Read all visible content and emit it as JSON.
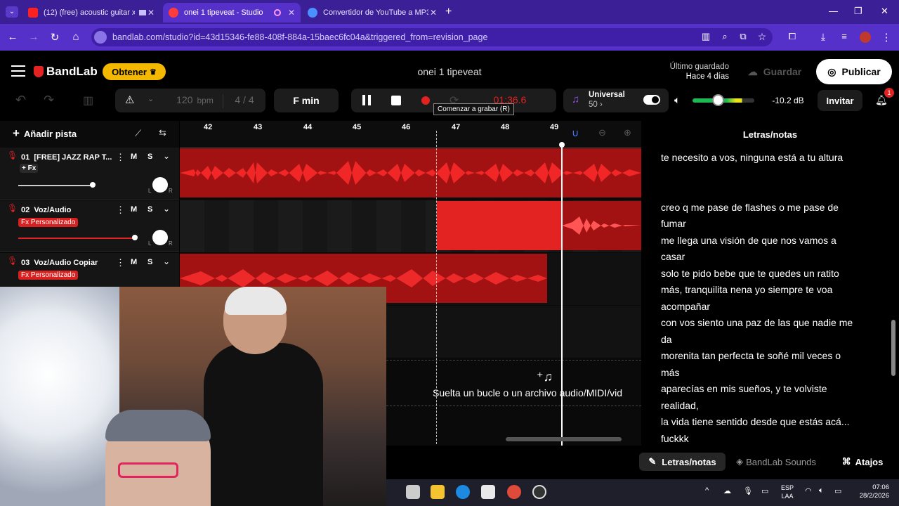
{
  "browser": {
    "tabs": [
      {
        "label": "(12) (free) acoustic guitar x",
        "icon": "youtube-icon"
      },
      {
        "label": "onei 1 tipeveat - Studio",
        "icon": "bandlab-icon"
      },
      {
        "label": "Convertidor de YouTube a MP3",
        "icon": "converter-icon"
      }
    ],
    "url": "bandlab.com/studio?id=43d15346-fe88-408f-884a-15baec6fc04a&triggered_from=revision_page"
  },
  "header": {
    "logo": "BandLab",
    "obtener": "Obtener",
    "project_title": "onei 1 tipeveat",
    "last_saved_label": "Último guardado",
    "last_saved_time": "Hace 4 días",
    "guardar": "Guardar",
    "publicar": "Publicar"
  },
  "transport": {
    "bpm": "120",
    "bpm_unit": "bpm",
    "time_sig": "4 / 4",
    "key": "F min",
    "time": "01:36.6",
    "tooltip": "Comenzar a grabar (R)",
    "universal_label": "Universal",
    "universal_value": "50",
    "volume_db": "-10.2 dB",
    "invitar": "Invitar",
    "notif_count": "1"
  },
  "tracks_panel": {
    "add_track": "Añadir pista"
  },
  "timeline": {
    "bars": [
      "42",
      "43",
      "44",
      "45",
      "46",
      "47",
      "48",
      "49"
    ],
    "drop_hint": "Suelta un bucle o un archivo audio/MIDI/vid"
  },
  "tracks": [
    {
      "num": "01",
      "name": "[FREE] JAZZ RAP T...",
      "fx": "+ Fx",
      "m": "M",
      "s": "S"
    },
    {
      "num": "02",
      "name": "Voz/Audio",
      "fx": "Fx Personalizado",
      "m": "M",
      "s": "S"
    },
    {
      "num": "03",
      "name": "Voz/Audio Copiar",
      "fx": "Fx Personalizado",
      "m": "M",
      "s": "S"
    }
  ],
  "lyrics": {
    "title": "Letras/notas",
    "lines": [
      "te necesito a vos, ninguna está a tu altura",
      "",
      "",
      "creo q me pase de flashes o me pase de",
      "fumar",
      "me llega una visión de que nos vamos a",
      "casar",
      "solo te pido bebe que te quedes un ratito",
      "más, tranquilita nena yo siempre te voa",
      "acompañar",
      "con vos siento una paz de las que nadie me",
      "da",
      "morenita tan perfecta te soñé mil veces o",
      "más",
      "aparecías en mis sueños,  y te volviste",
      "realidad,",
      "la vida tiene sentido desde que estás acá...",
      "fuckkk"
    ]
  },
  "bottom_tabs": {
    "letras": "Letras/notas",
    "sounds": "BandLab Sounds",
    "atajos": "Atajos"
  },
  "taskbar": {
    "lang1": "ESP",
    "lang2": "LAA",
    "time": "07:06",
    "date": "28/2/2026"
  },
  "colors": {
    "browser_purple": "#5631c9",
    "accent_red": "#e32222",
    "obtener_yellow": "#f5b800"
  }
}
